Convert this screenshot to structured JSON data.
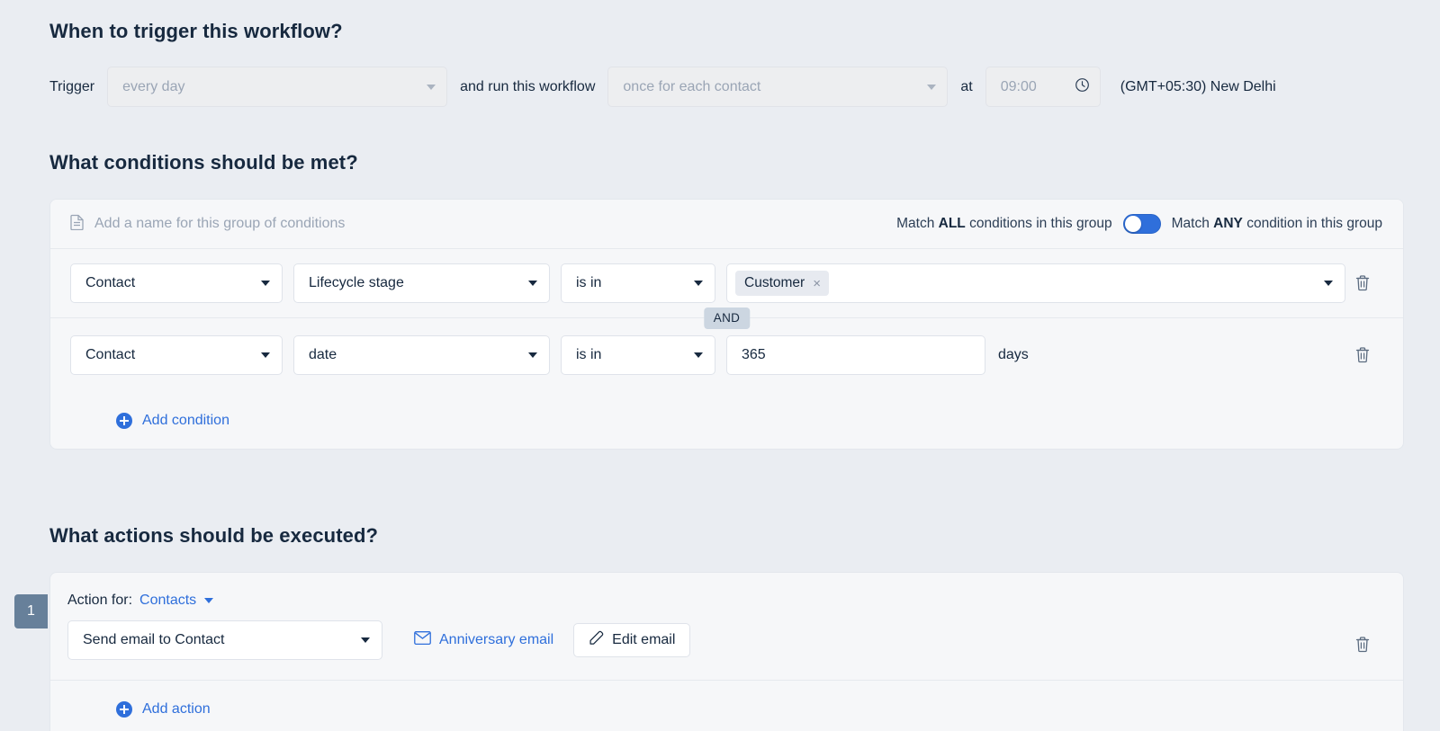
{
  "trigger_section": {
    "title": "When to trigger this workflow?",
    "trigger_label": "Trigger",
    "trigger_value": "every day",
    "run_label": "and run this workflow",
    "run_value": "once for each contact",
    "at_label": "at",
    "time_value": "09:00",
    "timezone": "(GMT+05:30) New Delhi"
  },
  "conditions_section": {
    "title": "What conditions should be met?",
    "group_name_placeholder": "Add a name for this group of conditions",
    "match_all_prefix": "Match ",
    "match_all_strong": "ALL",
    "match_all_suffix": " conditions in this group",
    "match_any_prefix": "Match ",
    "match_any_strong": "ANY",
    "match_any_suffix": " condition in this group",
    "toggle_state": "any",
    "joiner": "AND",
    "add_condition_label": "Add condition",
    "rows": [
      {
        "subject": "Contact",
        "field": "Lifecycle stage",
        "operator": "is in",
        "value_chip": "Customer",
        "chip_close": "×"
      },
      {
        "subject": "Contact",
        "field": "date",
        "operator": "is in",
        "value": "365",
        "unit": "days"
      }
    ]
  },
  "actions_section": {
    "title": "What actions should be executed?",
    "step_number": "1",
    "action_for_label": "Action for:",
    "action_for_value": "Contacts",
    "action_value": "Send email to Contact",
    "email_name": "Anniversary email",
    "edit_email_label": "Edit email",
    "add_action_label": "Add action"
  },
  "colors": {
    "page_bg": "#eaedf2",
    "card_bg": "#f6f7f9",
    "accent_blue": "#2f6fdb",
    "text_dark": "#17293f",
    "muted": "#9aa5b5",
    "badge_slate": "#67809a",
    "chip_bg": "#e7eaf0",
    "and_badge_bg": "#ccd6e1"
  }
}
